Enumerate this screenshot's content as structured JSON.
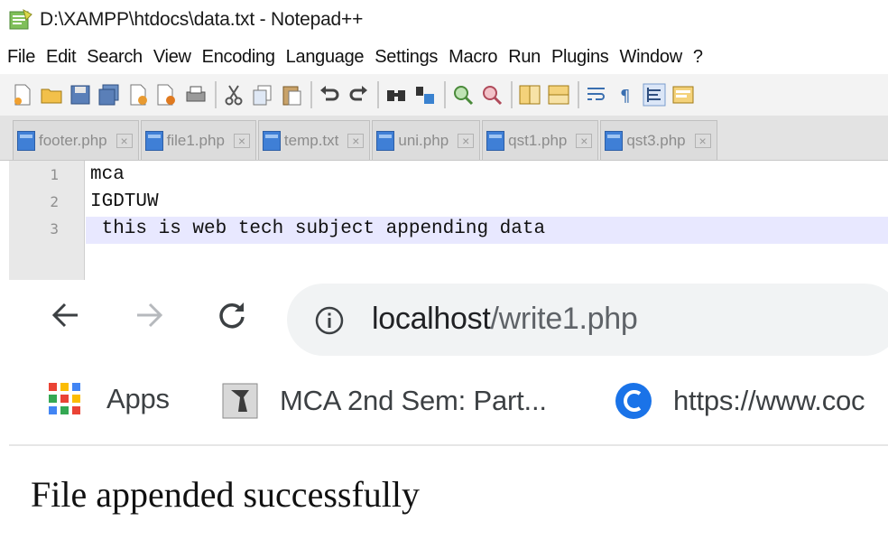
{
  "notepad": {
    "title": "D:\\XAMPP\\htdocs\\data.txt - Notepad++",
    "menu": [
      "File",
      "Edit",
      "Search",
      "View",
      "Encoding",
      "Language",
      "Settings",
      "Macro",
      "Run",
      "Plugins",
      "Window",
      "?"
    ],
    "tabs": [
      {
        "label": "footer.php"
      },
      {
        "label": "file1.php"
      },
      {
        "label": "temp.txt"
      },
      {
        "label": "uni.php"
      },
      {
        "label": "qst1.php"
      },
      {
        "label": "qst3.php"
      }
    ],
    "tab_close_glyph": "×",
    "lines": [
      {
        "number": "1",
        "text": "mca"
      },
      {
        "number": "2",
        "text": "IGDTUW"
      },
      {
        "number": "3",
        "text": " this is web tech subject appending data"
      }
    ],
    "colors": {
      "current_line": "#e8e8ff",
      "tab_icon": "#3f7fd6"
    }
  },
  "browser": {
    "address": {
      "host": "localhost",
      "path": "/write1.php"
    },
    "bookmarks": [
      {
        "label": "Apps",
        "icon": "apps-grid-icon"
      },
      {
        "label": "MCA 2nd Sem: Part...",
        "icon": "bookmark-page-icon"
      },
      {
        "label": "https://www.coc",
        "icon": "circle-c-icon"
      }
    ],
    "page_text": "File appended successfully",
    "colors": {
      "omnibox": "#f1f3f4",
      "bookmark_c_icon": "#1a73e8"
    }
  }
}
